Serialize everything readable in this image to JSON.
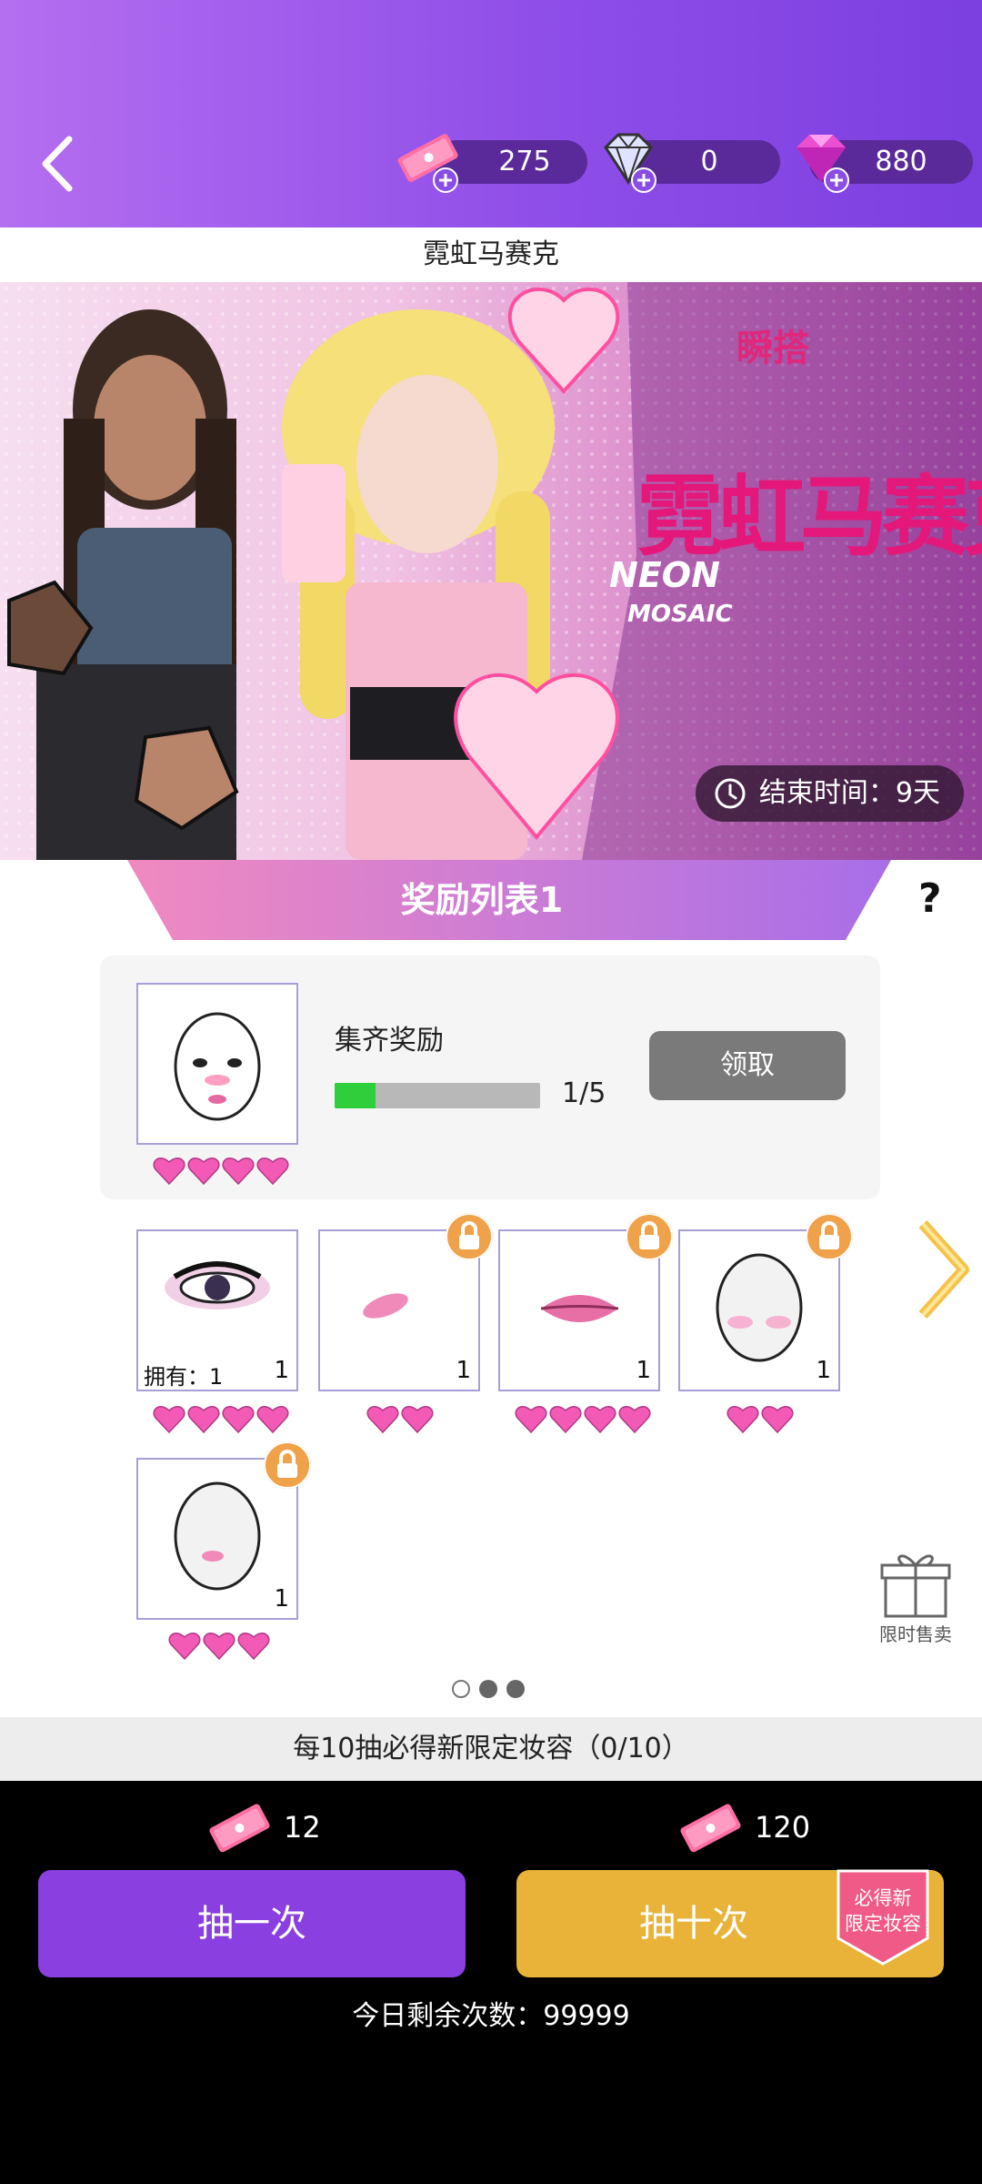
{
  "header": {
    "currencies": [
      {
        "name": "ticket",
        "value": "275"
      },
      {
        "name": "diamond",
        "value": "0"
      },
      {
        "name": "gem",
        "value": "880"
      }
    ]
  },
  "event": {
    "title": "霓虹马赛克",
    "banner_logo_cn": "霓虹马赛克",
    "banner_logo_en_1": "NEON",
    "banner_logo_en_2": "MOSAIC",
    "brand": "瞬搭",
    "end_time": "结束时间：9天"
  },
  "rewards": {
    "tab_title": "奖励列表1",
    "help": "?",
    "collect": {
      "label": "集齐奖励",
      "progress_text": "1/5",
      "progress_fraction": 0.2,
      "claim_label": "领取",
      "hearts": 4
    },
    "items": [
      {
        "name": "eye-makeup",
        "owned_label": "拥有：1",
        "count": "1",
        "locked": false,
        "hearts": 4
      },
      {
        "name": "blush",
        "count": "1",
        "locked": true,
        "hearts": 2
      },
      {
        "name": "lips",
        "count": "1",
        "locked": true,
        "hearts": 4
      },
      {
        "name": "face-blush",
        "count": "1",
        "locked": true,
        "hearts": 2
      },
      {
        "name": "face-nose",
        "count": "1",
        "locked": true,
        "hearts": 3
      }
    ],
    "gift_label": "限时售卖",
    "pagination": {
      "total": 3,
      "active": 0
    }
  },
  "guarantee_text": "每10抽必得新限定妆容（0/10）",
  "draw": {
    "single": {
      "label": "抽一次",
      "cost": "12"
    },
    "ten": {
      "label": "抽十次",
      "cost": "120",
      "badge_line1": "必得新",
      "badge_line2": "限定妆容"
    },
    "remaining": "今日剩余次数：99999"
  },
  "colors": {
    "header": "#8f4ee8",
    "single_button": "#8a3fe0",
    "ten_button": "#e9b33a",
    "heart": "#f25ab6",
    "lock": "#f0a24a",
    "progress": "#2fcf3c"
  }
}
